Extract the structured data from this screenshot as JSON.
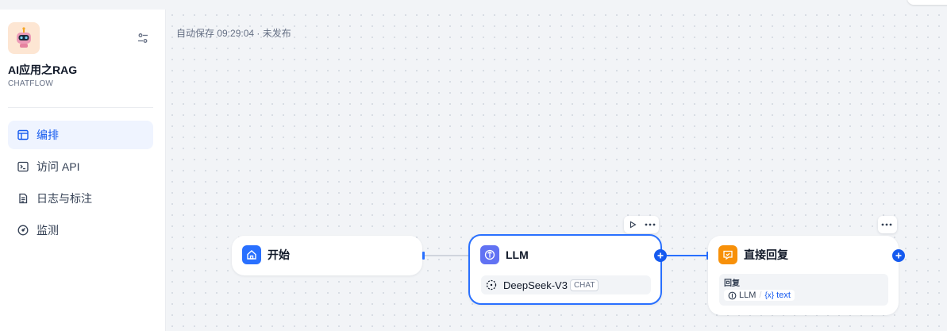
{
  "app": {
    "name": "AI应用之RAG",
    "type": "CHATFLOW"
  },
  "nav": {
    "items": [
      {
        "label": "编排",
        "icon": "layout-icon",
        "active": true
      },
      {
        "label": "访问 API",
        "icon": "terminal-icon",
        "active": false
      },
      {
        "label": "日志与标注",
        "icon": "file-list-icon",
        "active": false
      },
      {
        "label": "监测",
        "icon": "gauge-icon",
        "active": false
      }
    ]
  },
  "canvas": {
    "autosave": "自动保存 09:29:04 · 未发布"
  },
  "nodes": {
    "start": {
      "title": "开始",
      "icon": "home-icon",
      "color": "#2970ff"
    },
    "llm": {
      "title": "LLM",
      "icon": "llm-icon",
      "color": "#6172f3",
      "model": "DeepSeek-V3",
      "mode": "CHAT",
      "model_icon": "deepseek-icon"
    },
    "answer": {
      "title": "直接回复",
      "icon": "answer-icon",
      "color": "#f79009",
      "reply_label": "回复",
      "var_source": "LLM",
      "var_sep": "/",
      "var_symbol": "{x}",
      "var_name": "text"
    }
  },
  "colors": {
    "accent": "#155aef",
    "active_bg": "#eff4ff"
  }
}
